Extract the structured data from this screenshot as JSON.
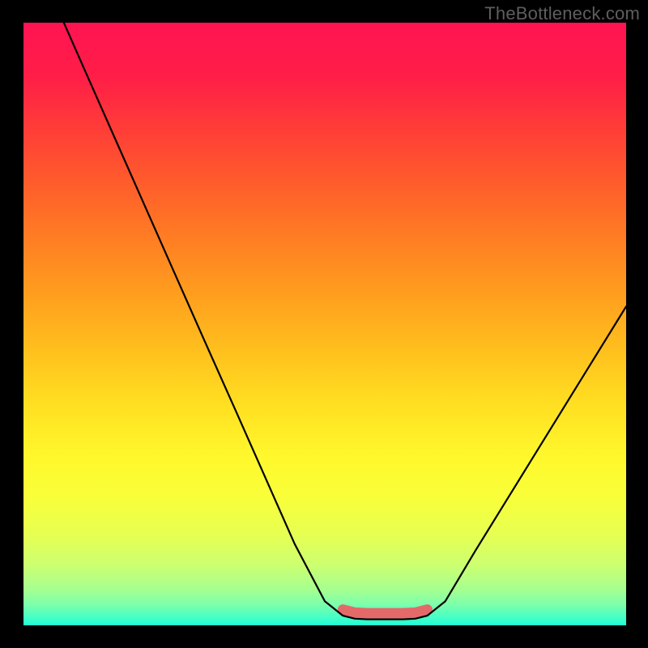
{
  "watermark": "TheBottleneck.com",
  "gradient": {
    "stops": [
      {
        "offset": 0.0,
        "color": "#ff1452"
      },
      {
        "offset": 0.09,
        "color": "#ff1e47"
      },
      {
        "offset": 0.18,
        "color": "#ff3e37"
      },
      {
        "offset": 0.27,
        "color": "#ff5e2b"
      },
      {
        "offset": 0.36,
        "color": "#ff7e23"
      },
      {
        "offset": 0.45,
        "color": "#ff9e1e"
      },
      {
        "offset": 0.54,
        "color": "#ffbe1d"
      },
      {
        "offset": 0.63,
        "color": "#ffde21"
      },
      {
        "offset": 0.72,
        "color": "#fff82c"
      },
      {
        "offset": 0.79,
        "color": "#f8ff3a"
      },
      {
        "offset": 0.85,
        "color": "#e6ff52"
      },
      {
        "offset": 0.9,
        "color": "#ccff70"
      },
      {
        "offset": 0.94,
        "color": "#a6ff8f"
      },
      {
        "offset": 0.965,
        "color": "#7effab"
      },
      {
        "offset": 0.985,
        "color": "#4affc4"
      },
      {
        "offset": 1.0,
        "color": "#1effd5"
      }
    ]
  },
  "chart_data": {
    "type": "line",
    "title": "",
    "xlabel": "",
    "ylabel": "",
    "xlim": [
      0,
      100
    ],
    "ylim": [
      0,
      100
    ],
    "grid": false,
    "legend": null,
    "series": [
      {
        "name": "bottleneck-curve",
        "color": "#000000",
        "x": [
          6.7,
          10,
          15,
          20,
          25,
          30,
          35,
          40,
          45,
          50,
          53,
          55,
          57,
          60,
          63,
          65,
          67,
          70,
          75,
          80,
          85,
          90,
          95,
          100
        ],
        "y": [
          100,
          92.5,
          81.2,
          69.9,
          58.6,
          47.3,
          36.1,
          24.8,
          13.5,
          4.0,
          1.6,
          1.1,
          1.0,
          1.0,
          1.0,
          1.1,
          1.6,
          4.0,
          12.4,
          20.5,
          28.6,
          36.7,
          44.8,
          52.9
        ]
      }
    ],
    "annotations": [
      {
        "name": "bottom-highlight",
        "shape": "rounded-band",
        "color": "#e46a6a",
        "x_start": 53,
        "x_end": 67,
        "y": 1.3
      }
    ]
  }
}
